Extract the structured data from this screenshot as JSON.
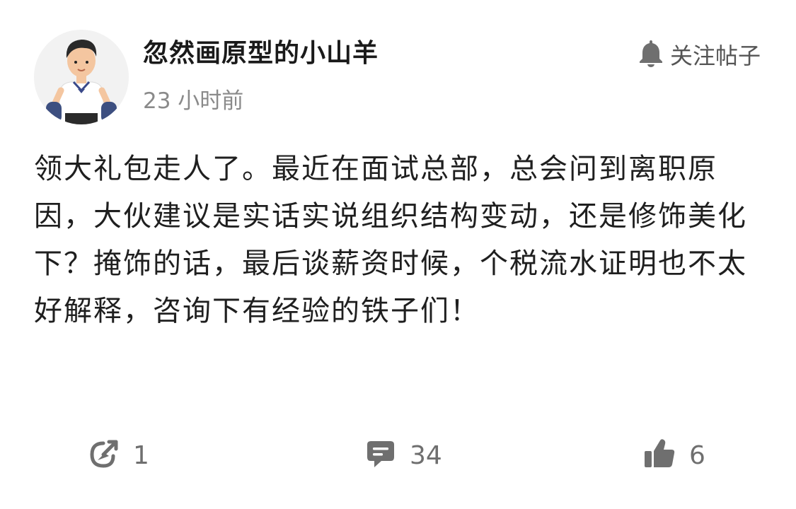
{
  "author": {
    "name": "忽然画原型的小山羊",
    "time": "23 小时前",
    "avatar_icon": "cartoon-boy-dumbbell-avatar"
  },
  "follow": {
    "label": "关注帖子",
    "icon": "bell-icon"
  },
  "post": {
    "content": "领大礼包走人了。最近在面试总部，总会问到离职原因，大伙建议是实话实说组织结构变动，还是修饰美化下？掩饰的话，最后谈薪资时候，个税流水证明也不太好解释，咨询下有经验的铁子们！"
  },
  "actions": {
    "share": {
      "icon": "share-arrow-icon",
      "count": "1"
    },
    "comment": {
      "icon": "comment-bubble-icon",
      "count": "34"
    },
    "like": {
      "icon": "thumbs-up-icon",
      "count": "6"
    }
  },
  "colors": {
    "icon_gray": "#6f6f6f",
    "text_main": "#1f1f1f",
    "text_muted": "#8a8a8a"
  }
}
